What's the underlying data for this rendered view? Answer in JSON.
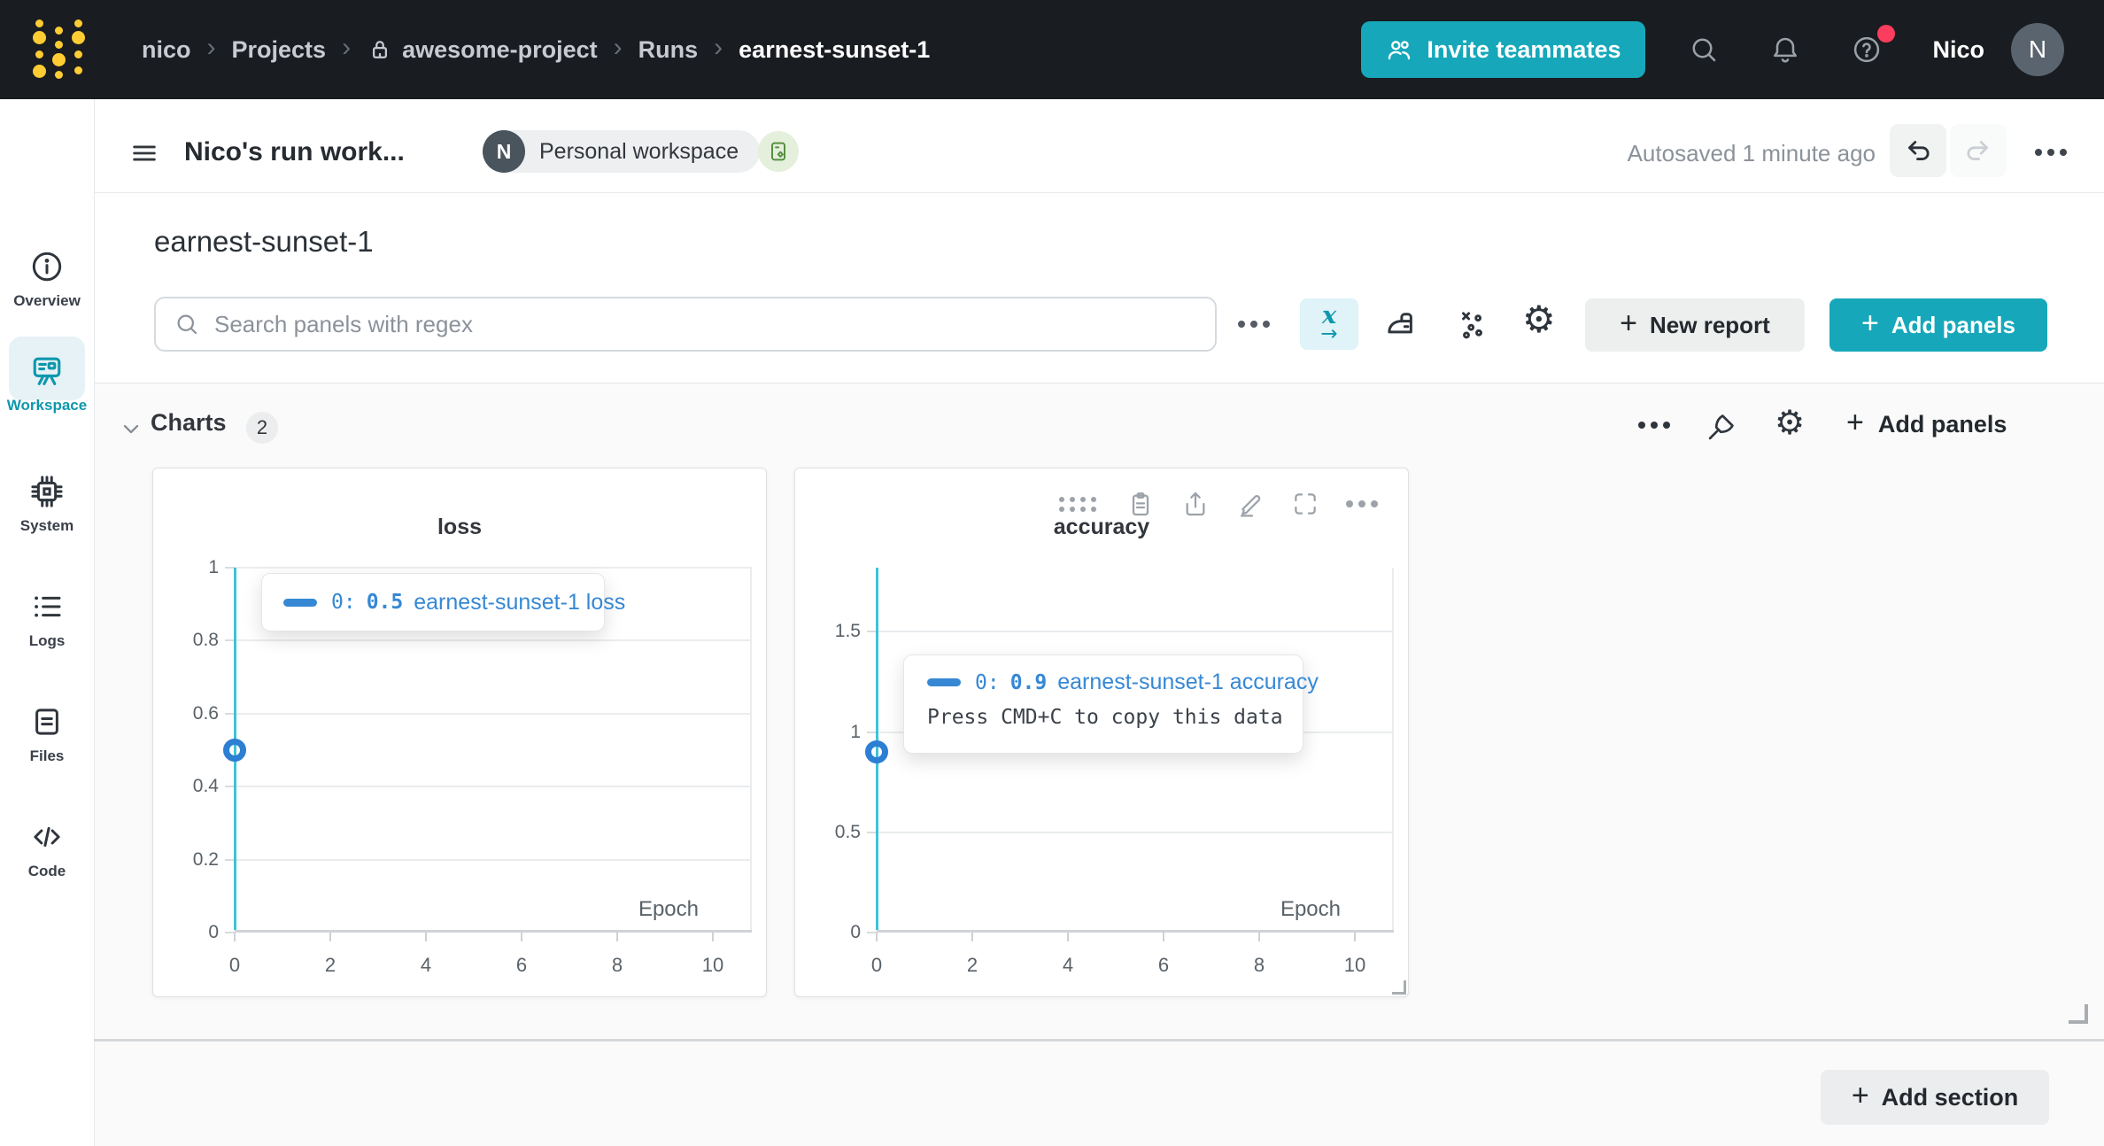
{
  "navbar": {
    "breadcrumb": [
      {
        "label": "nico"
      },
      {
        "label": "Projects"
      },
      {
        "label": "awesome-project"
      },
      {
        "label": "Runs"
      },
      {
        "label": "earnest-sunset-1"
      }
    ],
    "invite_button_label": "Invite teammates",
    "user_name": "Nico",
    "avatar_initial": "N"
  },
  "header": {
    "title": "Nico's run work...",
    "badge_initial": "N",
    "badge_label": "Personal workspace",
    "autosave_status": "Autosaved 1 minute ago"
  },
  "sidebar": {
    "items": [
      {
        "label": "Overview",
        "icon": "info-icon",
        "active": false
      },
      {
        "label": "Workspace",
        "icon": "workspace-board-icon",
        "active": true
      },
      {
        "label": "System",
        "icon": "cpu-chip-icon",
        "active": false
      },
      {
        "label": "Logs",
        "icon": "log-list-icon",
        "active": false
      },
      {
        "label": "Files",
        "icon": "file-icon",
        "active": false
      },
      {
        "label": "Code",
        "icon": "code-icon",
        "active": false
      }
    ]
  },
  "run_header": {
    "run_name": "earnest-sunset-1",
    "search_placeholder": "Search panels with regex",
    "new_report_label": "New report",
    "add_panels_label": "Add panels"
  },
  "charts_section": {
    "title": "Charts",
    "count": "2",
    "add_panels_label": "Add panels"
  },
  "footer": {
    "add_section_label": "Add section"
  },
  "chart_data": [
    {
      "type": "line",
      "title": "loss",
      "xlabel": "Epoch",
      "series": [
        {
          "name": "earnest-sunset-1 loss",
          "x": [
            0
          ],
          "y": [
            0.5
          ],
          "color": "#2C7FD2"
        }
      ],
      "xlim": [
        0,
        10
      ],
      "ylim": [
        0,
        1
      ],
      "xticks": [
        0,
        2,
        4,
        6,
        8,
        10
      ],
      "yticks": [
        0,
        0.2,
        0.4,
        0.6,
        0.8,
        1
      ],
      "grid": "horizontal",
      "legend_position": "tooltip",
      "crosshair_x": 0,
      "tooltip": {
        "step_label": "0:",
        "value": "0.5",
        "series_label": "earnest-sunset-1 loss"
      }
    },
    {
      "type": "line",
      "title": "accuracy",
      "xlabel": "Epoch",
      "series": [
        {
          "name": "earnest-sunset-1 accuracy",
          "x": [
            0
          ],
          "y": [
            0.9
          ],
          "color": "#2C7FD2"
        }
      ],
      "xlim": [
        0,
        10
      ],
      "ylim": [
        0,
        1.82
      ],
      "xticks": [
        0,
        2,
        4,
        6,
        8,
        10
      ],
      "yticks": [
        0,
        0.5,
        1,
        1.5
      ],
      "grid": "horizontal",
      "legend_position": "tooltip",
      "crosshair_x": 0,
      "tooltip": {
        "step_label": "0:",
        "value": "0.9",
        "series_label": "earnest-sunset-1 accuracy",
        "hint": "Press CMD+C to copy this data"
      }
    }
  ],
  "colors": {
    "navbar_bg": "#191C20",
    "logo_gold": "#FFCC33",
    "accent_teal": "#16A8BA",
    "active_nav_teal": "#0E97AD",
    "notification_red": "#FC3D5D",
    "series_blue": "#2C7FD2",
    "tooltip_blue": "#3688D4",
    "crosshair_cyan": "#3DC3D7",
    "section_bg": "#FAFAFA"
  }
}
